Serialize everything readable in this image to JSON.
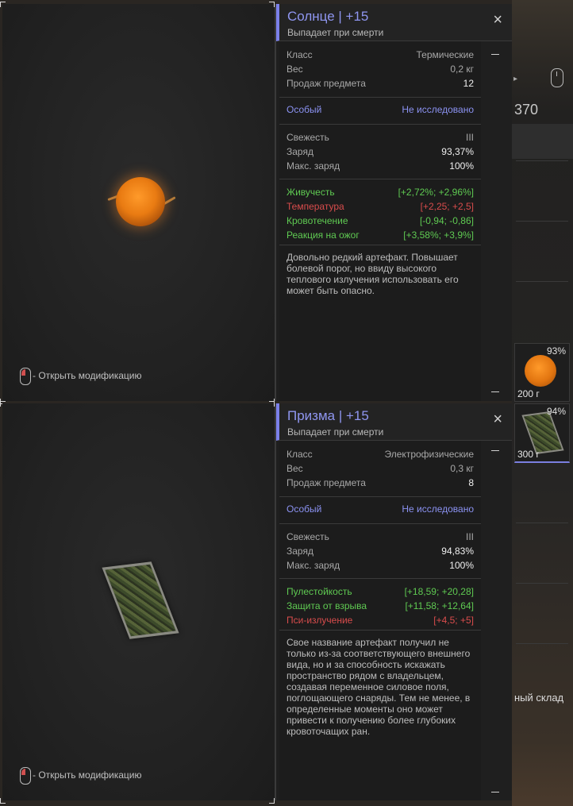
{
  "background": {
    "top_number": "370",
    "slots": [
      {
        "percent": "93%",
        "weight": "200 г",
        "icon": "sun-artifact-icon"
      },
      {
        "percent": "94%",
        "weight": "300 г",
        "icon": "prism-artifact-icon"
      }
    ],
    "stash_label": "ный склад"
  },
  "tooltips": [
    {
      "title": "Солнце | +15",
      "subtitle": "Выпадает при смерти",
      "props": [
        {
          "k": "Класс",
          "v": "Термические"
        },
        {
          "k": "Вес",
          "v": "0,2 кг"
        },
        {
          "k": "Продаж предмета",
          "v": "12"
        }
      ],
      "special": {
        "k": "Особый",
        "v": "Не исследовано"
      },
      "state": [
        {
          "k": "Свежесть",
          "v": "III"
        },
        {
          "k": "Заряд",
          "v": "93,37%"
        },
        {
          "k": "Макс. заряд",
          "v": "100%"
        }
      ],
      "effects": [
        {
          "k": "Живучесть",
          "v": "[+2,72%; +2,96%]",
          "color": "#5fca52"
        },
        {
          "k": "Температура",
          "v": "[+2,25; +2,5]",
          "color": "#d84c4c"
        },
        {
          "k": "Кровотечение",
          "v": "[-0,94; -0,86]",
          "color": "#5fca52"
        },
        {
          "k": "Реакция на ожог",
          "v": "[+3,58%; +3,9%]",
          "color": "#5fca52"
        }
      ],
      "description": "Довольно редкий артефакт. Повышает болевой порог, но ввиду высокого теплового излучения использовать его может быть опасно.",
      "hint": "- Открыть модификацию"
    },
    {
      "title": "Призма | +15",
      "subtitle": "Выпадает при смерти",
      "props": [
        {
          "k": "Класс",
          "v": "Электрофизические"
        },
        {
          "k": "Вес",
          "v": "0,3 кг"
        },
        {
          "k": "Продаж предмета",
          "v": "8"
        }
      ],
      "special": {
        "k": "Особый",
        "v": "Не исследовано"
      },
      "state": [
        {
          "k": "Свежесть",
          "v": "III"
        },
        {
          "k": "Заряд",
          "v": "94,83%"
        },
        {
          "k": "Макс. заряд",
          "v": "100%"
        }
      ],
      "effects": [
        {
          "k": "Пулестойкость",
          "v": "[+18,59; +20,28]",
          "color": "#5fca52"
        },
        {
          "k": "Защита от взрыва",
          "v": "[+11,58; +12,64]",
          "color": "#5fca52"
        },
        {
          "k": "Пси-излучение",
          "v": "[+4,5; +5]",
          "color": "#d84c4c"
        }
      ],
      "description": "Свое название артефакт получил не только из-за соответствующего внешнего вида, но и за способность искажать пространство рядом с владельцем, создавая переменное силовое поля, поглощающего снаряды. Тем не менее, в определенные моменты оно может привести к получению более глубоких кровоточащих ран.",
      "hint": "- Открыть модификацию"
    }
  ]
}
